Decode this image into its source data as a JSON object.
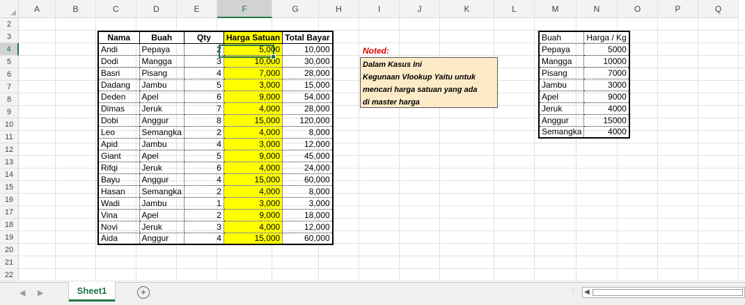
{
  "columns": [
    "A",
    "B",
    "C",
    "D",
    "E",
    "F",
    "G",
    "H",
    "I",
    "J",
    "K",
    "L",
    "M",
    "N",
    "O",
    "P",
    "Q"
  ],
  "rows": [
    "2",
    "3",
    "4",
    "5",
    "6",
    "7",
    "8",
    "9",
    "10",
    "11",
    "12",
    "13",
    "14",
    "15",
    "16",
    "17",
    "18",
    "19",
    "20",
    "21",
    "22"
  ],
  "selected_column": "F",
  "selected_row": "4",
  "main_table": {
    "headers": [
      "Nama",
      "Buah",
      "Qty",
      "Harga Satuan",
      "Total Bayar"
    ],
    "rows": [
      [
        "Andi",
        "Pepaya",
        "2",
        "5,000",
        "10,000"
      ],
      [
        "Dodi",
        "Mangga",
        "3",
        "10,000",
        "30,000"
      ],
      [
        "Basri",
        "Pisang",
        "4",
        "7,000",
        "28,000"
      ],
      [
        "Dadang",
        "Jambu",
        "5",
        "3,000",
        "15,000"
      ],
      [
        "Deden",
        "Apel",
        "6",
        "9,000",
        "54,000"
      ],
      [
        "Dimas",
        "Jeruk",
        "7",
        "4,000",
        "28,000"
      ],
      [
        "Dobi",
        "Anggur",
        "8",
        "15,000",
        "120,000"
      ],
      [
        "Leo",
        "Semangka",
        "2",
        "4,000",
        "8,000"
      ],
      [
        "Apid",
        "Jambu",
        "4",
        "3,000",
        "12,000"
      ],
      [
        "Giant",
        "Apel",
        "5",
        "9,000",
        "45,000"
      ],
      [
        "Rifqi",
        "Jeruk",
        "6",
        "4,000",
        "24,000"
      ],
      [
        "Bayu",
        "Anggur",
        "4",
        "15,000",
        "60,000"
      ],
      [
        "Hasan",
        "Semangka",
        "2",
        "4,000",
        "8,000"
      ],
      [
        "Wadi",
        "Jambu",
        "1",
        "3,000",
        "3,000"
      ],
      [
        "Vina",
        "Apel",
        "2",
        "9,000",
        "18,000"
      ],
      [
        "Novi",
        "Jeruk",
        "3",
        "4,000",
        "12,000"
      ],
      [
        "Aida",
        "Anggur",
        "4",
        "15,000",
        "60,000"
      ]
    ]
  },
  "note": {
    "title": "Noted:",
    "lines": [
      "Dalam Kasus Ini",
      "Kegunaan Vlookup Yaitu untuk",
      "mencari harga satuan yang ada",
      "di master harga"
    ]
  },
  "master_table": {
    "headers": [
      "Buah",
      "Harga / Kg"
    ],
    "rows": [
      [
        "Pepaya",
        "5000"
      ],
      [
        "Mangga",
        "10000"
      ],
      [
        "Pisang",
        "7000"
      ],
      [
        "Jambu",
        "3000"
      ],
      [
        "Apel",
        "9000"
      ],
      [
        "Jeruk",
        "4000"
      ],
      [
        "Anggur",
        "15000"
      ],
      [
        "Semangka",
        "4000"
      ]
    ]
  },
  "sheet_tab": {
    "label": "Sheet1"
  },
  "colors": {
    "accent": "#217346",
    "highlight": "#ffff00",
    "note_bg": "#fdebc8",
    "note_title": "#e00000"
  }
}
